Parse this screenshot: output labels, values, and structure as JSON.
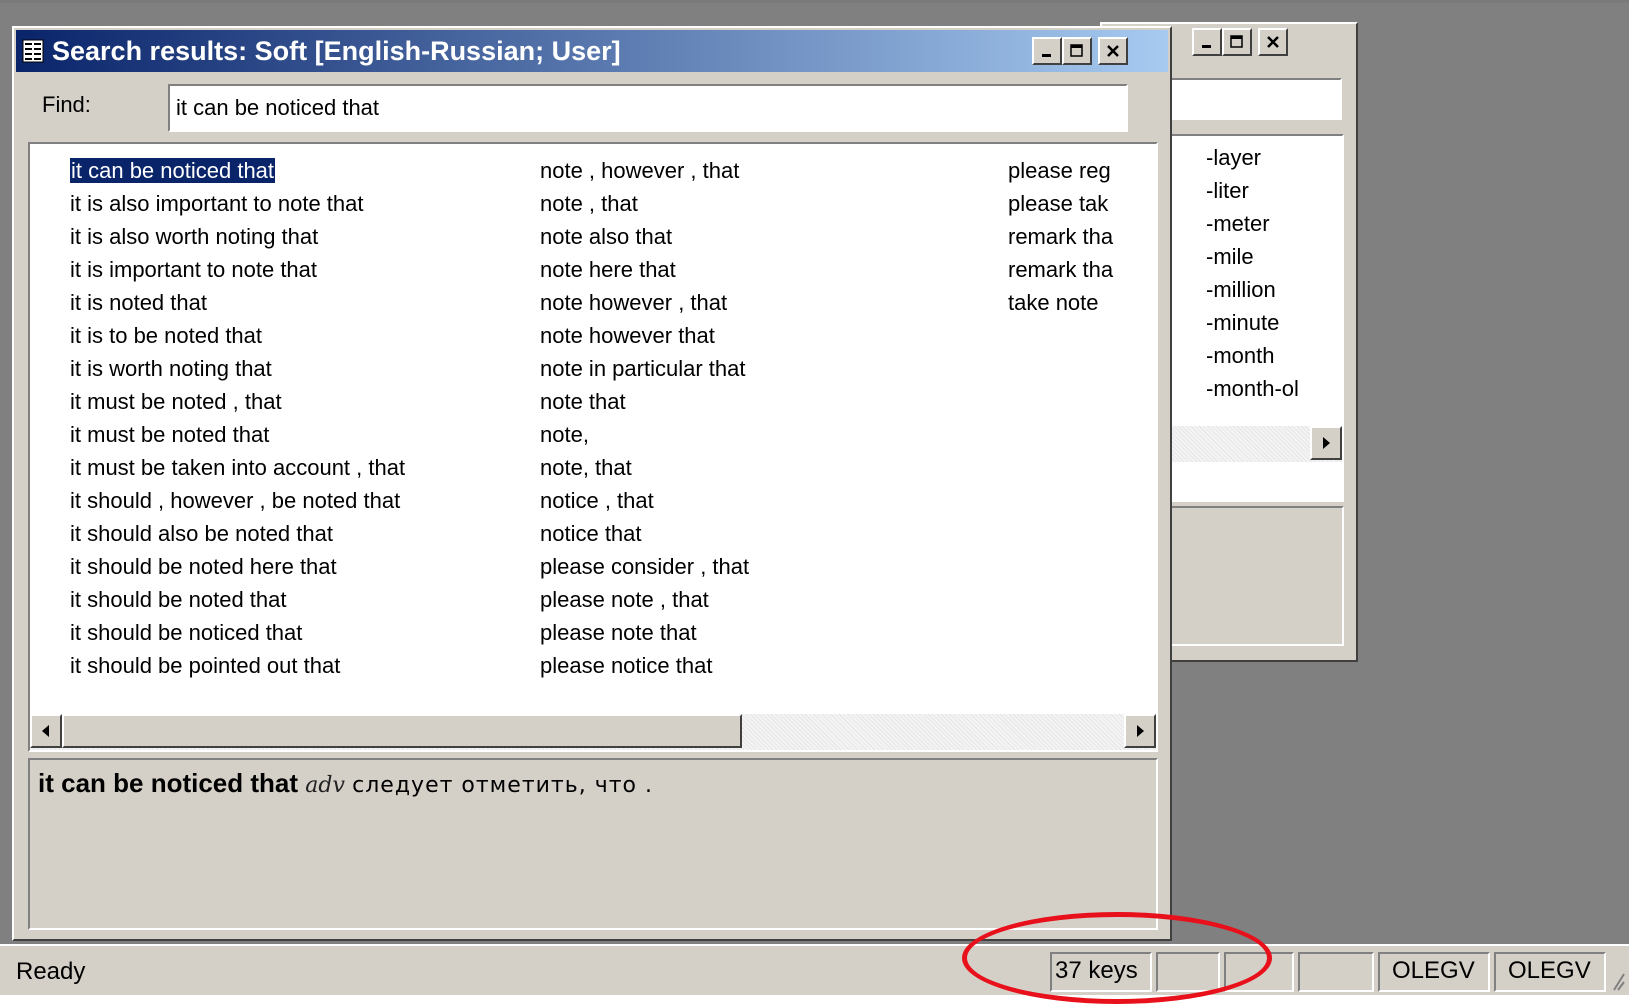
{
  "colors": {
    "title_active_start": "#0a246a",
    "title_active_end": "#a6caf0",
    "selection": "#0a246a",
    "annotation": "#e8101a",
    "face": "#d4d0c8",
    "mdi_background": "#808080"
  },
  "window": {
    "title": "Search results: Soft [English-Russian; User]",
    "icon": "search-results-icon"
  },
  "find": {
    "label": "Find:",
    "value": "it can be noticed that"
  },
  "results": {
    "columns": [
      [
        "it can be noticed that",
        "it is also important to note that",
        "it is also worth noting that",
        "it is important to note that",
        "it is noted that",
        "it is to be noted that",
        "it is worth noting that",
        "it must be noted , that",
        "it must be noted that",
        "it must be taken into account , that",
        "it should , however , be noted that",
        "it should also be noted that",
        "it should be noted here that",
        "it should be noted that",
        "it should be noticed that",
        "it should be pointed out that"
      ],
      [
        "note , however , that",
        "note , that",
        "note also that",
        "note here that",
        "note however , that",
        "note however that",
        "note in particular that",
        "note that",
        "note,",
        "note, that",
        "notice , that",
        "notice that",
        "please consider , that",
        "please note , that",
        "please note that",
        "please notice that"
      ],
      [
        "please reg",
        "please tak",
        "remark tha",
        "remark tha",
        "take note"
      ]
    ],
    "selected": "it can be noticed that"
  },
  "definition": {
    "headword": "it can be noticed that",
    "pos": "adv",
    "translation": "следует отметить, что ."
  },
  "background_window": {
    "items": [
      "-layer",
      "-liter",
      "-meter",
      "-mile",
      "-million",
      "-minute",
      "-month",
      "-month-ol"
    ]
  },
  "statusbar": {
    "ready": "Ready",
    "keys": "37 keys",
    "user1": "OLEGV",
    "user2": "OLEGV"
  }
}
